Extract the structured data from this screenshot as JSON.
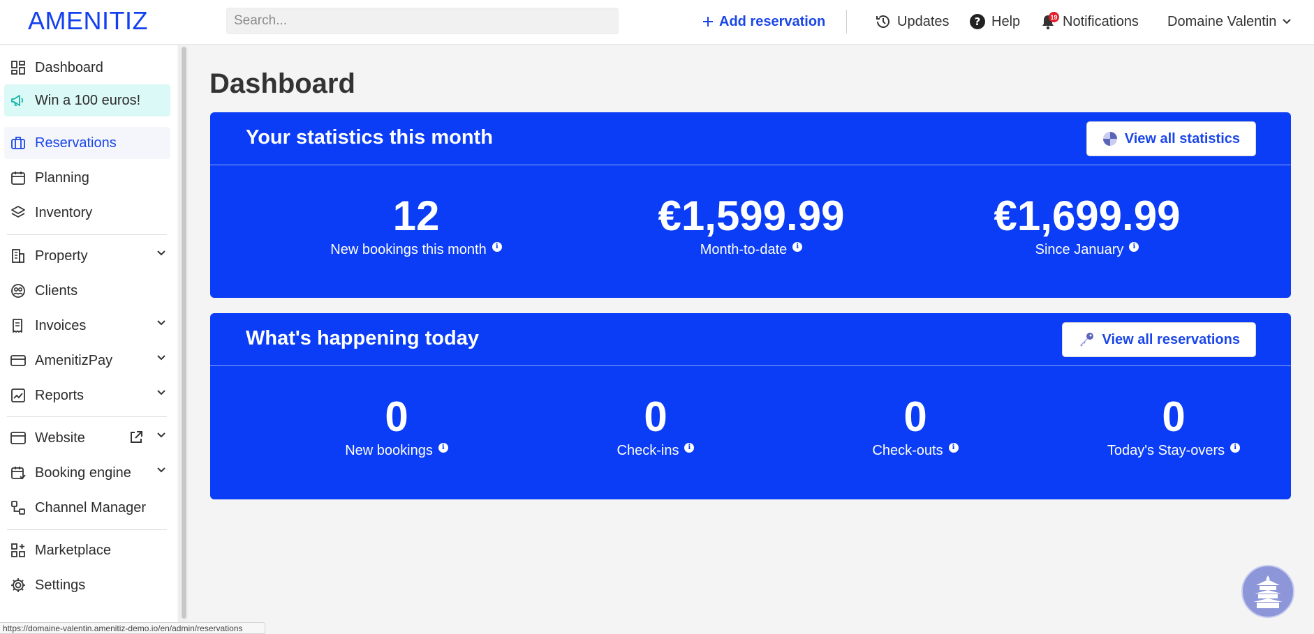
{
  "brand": {
    "logo_text": "AMENITIZ",
    "accent": "#1240f0",
    "panel_color": "#0a3df5"
  },
  "topbar": {
    "search_placeholder": "Search...",
    "add_reservation": "Add reservation",
    "updates": "Updates",
    "help": "Help",
    "notifications": "Notifications",
    "notifications_count": "19",
    "account": "Domaine Valentin"
  },
  "sidebar": {
    "items": [
      {
        "label": "Dashboard",
        "icon": "dashboard-icon"
      },
      {
        "label": "Win a 100 euros!",
        "icon": "megaphone-icon"
      },
      {
        "label": "Reservations",
        "icon": "suitcase-icon"
      },
      {
        "label": "Planning",
        "icon": "calendar-icon"
      },
      {
        "label": "Inventory",
        "icon": "layers-icon"
      },
      {
        "label": "Property",
        "icon": "building-icon"
      },
      {
        "label": "Clients",
        "icon": "clients-icon"
      },
      {
        "label": "Invoices",
        "icon": "invoice-icon"
      },
      {
        "label": "AmenitizPay",
        "icon": "card-icon"
      },
      {
        "label": "Reports",
        "icon": "chart-icon"
      },
      {
        "label": "Website",
        "icon": "browser-icon"
      },
      {
        "label": "Booking engine",
        "icon": "booking-icon"
      },
      {
        "label": "Channel Manager",
        "icon": "channel-icon"
      },
      {
        "label": "Marketplace",
        "icon": "grid-plus-icon"
      },
      {
        "label": "Settings",
        "icon": "gear-icon"
      }
    ]
  },
  "status_url": "https://domaine-valentin.amenitiz-demo.io/en/admin/reservations",
  "main": {
    "title": "Dashboard",
    "stats_panel": {
      "title": "Your statistics this month",
      "button": "View all statistics",
      "stats": [
        {
          "value": "12",
          "label": "New bookings this month"
        },
        {
          "value": "€1,599.99",
          "label": "Month-to-date"
        },
        {
          "value": "€1,699.99",
          "label": "Since January"
        }
      ]
    },
    "today_panel": {
      "title": "What's happening today",
      "button": "View all reservations",
      "stats": [
        {
          "value": "0",
          "label": "New bookings"
        },
        {
          "value": "0",
          "label": "Check-ins"
        },
        {
          "value": "0",
          "label": "Check-outs"
        },
        {
          "value": "0",
          "label": "Today's Stay-overs"
        }
      ]
    }
  }
}
